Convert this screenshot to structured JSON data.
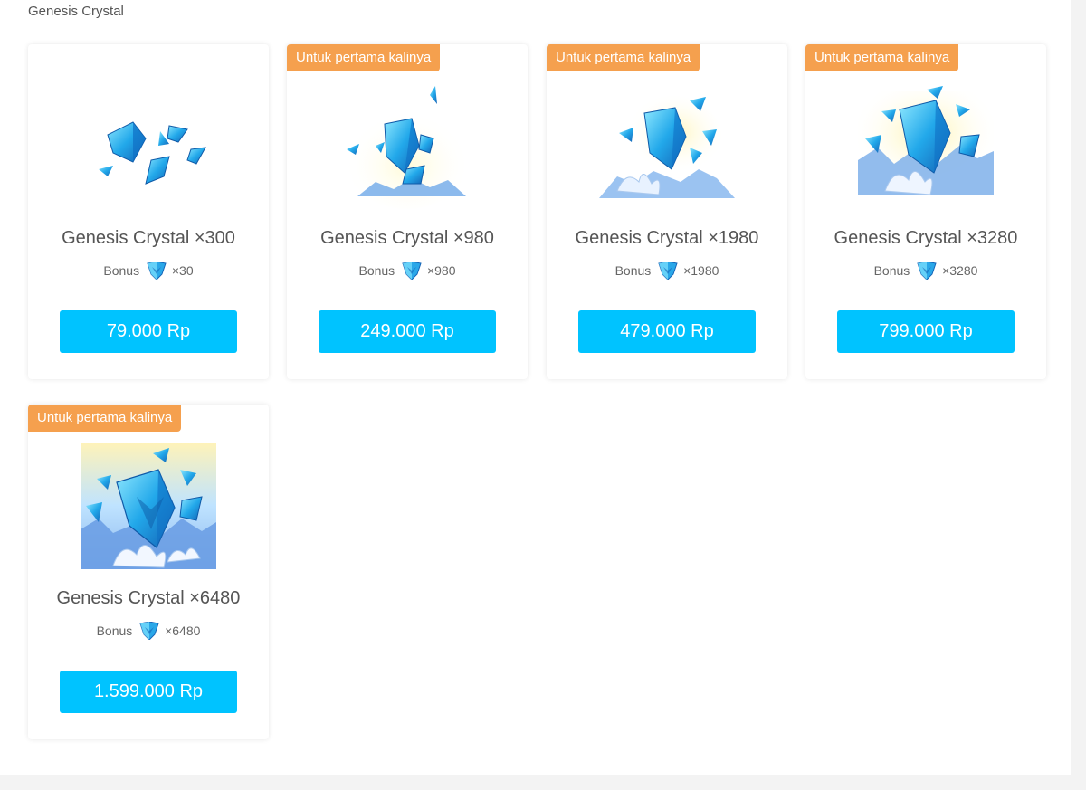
{
  "section_title": "Genesis Crystal",
  "colors": {
    "button": "#00c3ff",
    "badge": "#f5a04e",
    "title_text": "#555555",
    "crystal_light": "#7fe3ff",
    "crystal_mid": "#21a9ea",
    "crystal_dark": "#1565b8"
  },
  "bonus_icon": "genesis-crystal-icon",
  "products": [
    {
      "badge": "",
      "title": "Genesis Crystal ×300",
      "bonus_label": "Bonus",
      "bonus_amount": "×30",
      "price": "79.000 Rp",
      "art_icon": "genesis-crystal-pile-small-icon"
    },
    {
      "badge": "Untuk pertama kalinya",
      "title": "Genesis Crystal ×980",
      "bonus_label": "Bonus",
      "bonus_amount": "×980",
      "price": "249.000 Rp",
      "art_icon": "genesis-crystal-pile-icon"
    },
    {
      "badge": "Untuk pertama kalinya",
      "title": "Genesis Crystal ×1980",
      "bonus_label": "Bonus",
      "bonus_amount": "×1980",
      "price": "479.000 Rp",
      "art_icon": "genesis-crystal-pile-flowers-icon"
    },
    {
      "badge": "Untuk pertama kalinya",
      "title": "Genesis Crystal ×3280",
      "bonus_label": "Bonus",
      "bonus_amount": "×3280",
      "price": "799.000 Rp",
      "art_icon": "genesis-crystal-pile-large-icon"
    },
    {
      "badge": "Untuk pertama kalinya",
      "title": "Genesis Crystal ×6480",
      "bonus_label": "Bonus",
      "bonus_amount": "×6480",
      "price": "1.599.000 Rp",
      "art_icon": "genesis-crystal-pile-huge-icon"
    }
  ]
}
